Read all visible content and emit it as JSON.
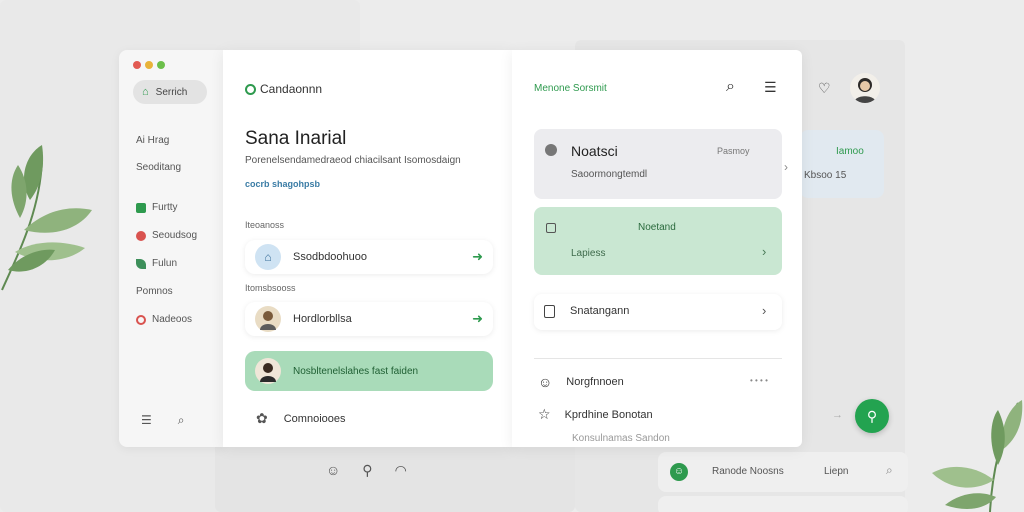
{
  "colors": {
    "accent": "#2e9a4e",
    "mint": "#c9e7d2",
    "mint_light": "#d7eedd",
    "gray_card": "#ececef",
    "blue_card": "#e6edf3"
  },
  "window": {
    "traffic_lights": [
      "#e25a52",
      "#e8b33a",
      "#6cbf4a"
    ],
    "sidebar": {
      "search_label": "Serrich",
      "items": [
        {
          "label": "Ai Hrag",
          "icon": ""
        },
        {
          "label": "Seoditang",
          "icon": ""
        },
        {
          "label": "Furtty",
          "icon": "green-square-icon"
        },
        {
          "label": "Seoudsog",
          "icon": "red-flower-icon"
        },
        {
          "label": "Fulun",
          "icon": "leaf-icon"
        },
        {
          "label": "Pomnos",
          "icon": ""
        },
        {
          "label": "Nadeoos",
          "icon": "red-gear-icon"
        }
      ],
      "bottom_icons": [
        "list-icon",
        "search-icon"
      ]
    },
    "middle": {
      "brand": "Candaonnn",
      "title": "Sana Inarial",
      "subtitle": "Porenelsendamedraeod chiacilsant Isomosdaign",
      "link": "cocrb shagohpsb",
      "section1": "Iteoanoss",
      "section2": "Itomsbsooss",
      "rows": [
        {
          "label": "Ssodbdoohuoo",
          "icon": "chat-bubble-icon"
        },
        {
          "label": "Hordlorbllsa",
          "icon": "person-avatar-icon"
        },
        {
          "label": "Nosbltenelslahes fast faiden",
          "icon": "person-avatar-icon"
        }
      ],
      "footer_item": "Comnoiooes"
    },
    "right": {
      "header": "Menone Sorsmit",
      "cards": [
        {
          "title": "Noatsci",
          "meta": "Pasmoy",
          "sub": "Saoormongtemdl"
        },
        {
          "title": "Noetand",
          "sub": "Lapiess"
        },
        {
          "title": "Snatangann"
        }
      ],
      "list": [
        {
          "label": "Norgfnnoen",
          "extra": "• • • •"
        },
        {
          "label": "Kprdhine Bonotan"
        },
        {
          "label": "Konsulnamas Sandon"
        }
      ]
    }
  },
  "background": {
    "card_blue": {
      "title": "Iamoo",
      "sub": "Kbsoo 15"
    },
    "bottom_bar": {
      "label": "Ranode Noosns",
      "right_label": "Liepn"
    }
  }
}
